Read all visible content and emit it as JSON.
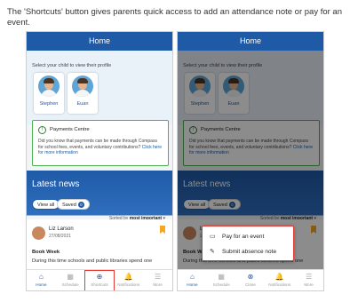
{
  "caption": "The 'Shortcuts' button gives parents quick access to add an attendance note or pay for an event.",
  "header_title": "Home",
  "select_child_label": "Select your child to view their profile",
  "children": [
    {
      "name": "Stephen"
    },
    {
      "name": "Euan"
    }
  ],
  "payments": {
    "title": "Payments Centre",
    "body": "Did you know that payments can be made through Compass for school fees, events, and voluntary contributions?",
    "link": "Click here for more information"
  },
  "latest_news": "Latest news",
  "view_all": "View all",
  "saved_label": "Saved",
  "saved_count": "0",
  "sorted_by": "Sorted by",
  "sort_value": "most important",
  "news_item": {
    "author": "Liz Larson",
    "date": "27/08/2021",
    "title": "Book Week",
    "text": "During this time schools and public libraries spend one"
  },
  "nav_left": [
    {
      "label": "Home",
      "icon": "home-icon",
      "glyph": "⌂"
    },
    {
      "label": "Schedule",
      "icon": "calendar-icon",
      "glyph": "▦"
    },
    {
      "label": "Shortcuts",
      "icon": "plus-circle-icon",
      "glyph": "⊕"
    },
    {
      "label": "Notifications",
      "icon": "bell-icon",
      "glyph": "🔔"
    },
    {
      "label": "More",
      "icon": "menu-icon",
      "glyph": "☰"
    }
  ],
  "nav_right": [
    {
      "label": "Home",
      "icon": "home-icon",
      "glyph": "⌂"
    },
    {
      "label": "Schedule",
      "icon": "calendar-icon",
      "glyph": "▦"
    },
    {
      "label": "Close",
      "icon": "close-circle-icon",
      "glyph": "⊗"
    },
    {
      "label": "Notifications",
      "icon": "bell-icon",
      "glyph": "🔔"
    },
    {
      "label": "More",
      "icon": "menu-icon",
      "glyph": "☰"
    }
  ],
  "shortcut_menu": [
    {
      "label": "Pay for an event",
      "icon": "card-icon",
      "glyph": "▭"
    },
    {
      "label": "Submit absence note",
      "icon": "edit-note-icon",
      "glyph": "✎"
    }
  ],
  "colors": {
    "brand": "#1f5aa6",
    "highlight": "#e53935",
    "bookmark": "#f5a623",
    "payments_border": "#4caf50"
  }
}
